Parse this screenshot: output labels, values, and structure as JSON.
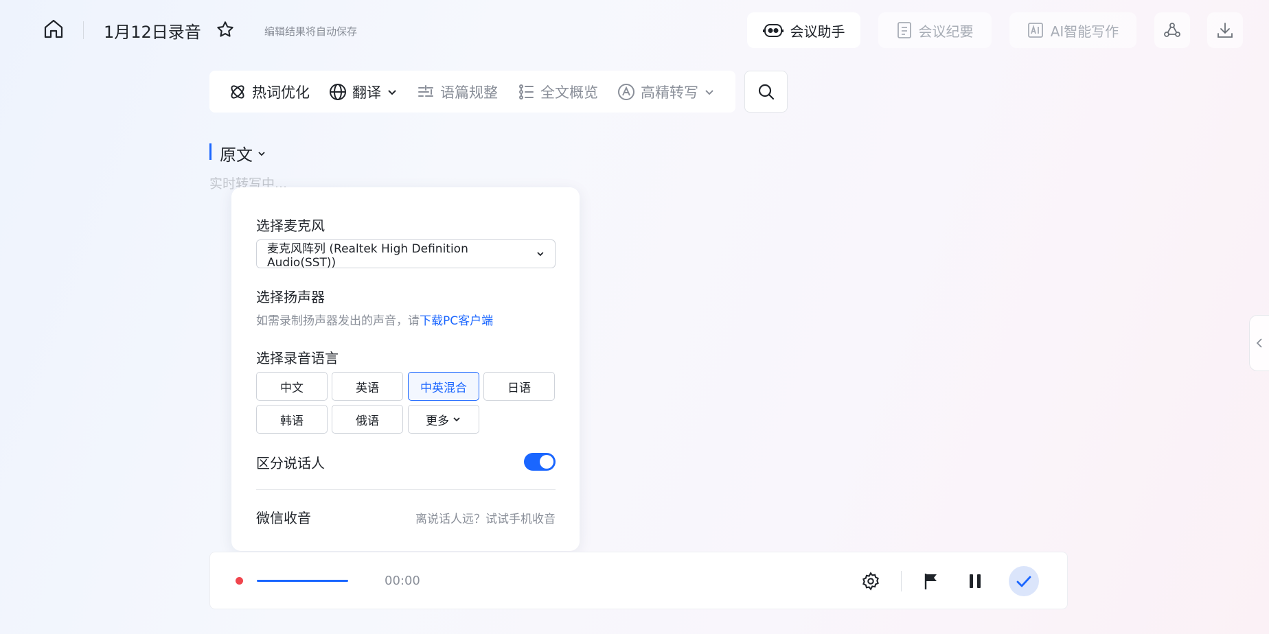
{
  "header": {
    "title": "1月12日录音",
    "autosave": "编辑结果将自动保存",
    "buttons": [
      {
        "label": "会议助手",
        "icon": "robot-icon"
      },
      {
        "label": "会议纪要",
        "icon": "document-icon"
      },
      {
        "label": "AI智能写作",
        "icon": "ai-icon"
      }
    ]
  },
  "toolbar": {
    "items": [
      {
        "label": "热词优化",
        "icon": "hotword-icon"
      },
      {
        "label": "翻译",
        "icon": "globe-icon"
      },
      {
        "label": "语篇规整",
        "icon": "format-icon"
      },
      {
        "label": "全文概览",
        "icon": "overview-icon"
      },
      {
        "label": "高精转写",
        "icon": "accurate-transcribe-icon"
      }
    ]
  },
  "transcript": {
    "section_label": "原文",
    "status": "实时转写中..."
  },
  "settings_popup": {
    "mic_heading": "选择麦克风",
    "mic_value": "麦克风阵列 (Realtek High Definition Audio(SST))",
    "speaker_heading": "选择扬声器",
    "speaker_note": "如需录制扬声器发出的声音，请",
    "speaker_link": "下载PC客户端",
    "lang_heading": "选择录音语言",
    "languages": [
      "中文",
      "英语",
      "中英混合",
      "日语",
      "韩语",
      "俄语"
    ],
    "more_label": "更多",
    "selected_language": "中英混合",
    "speaker_diarization_label": "区分说话人",
    "speaker_diarization_on": true,
    "wechat_label": "微信收音",
    "wechat_hint": "离说话人远？试试手机收音"
  },
  "recorder": {
    "time": "00:00"
  },
  "colors": {
    "accent": "#1a66ff",
    "record": "#f0454d"
  }
}
